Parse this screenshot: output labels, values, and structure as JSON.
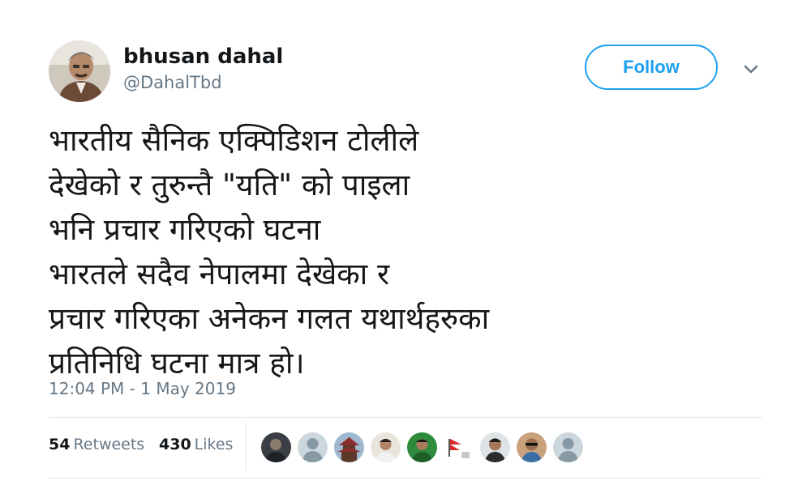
{
  "tweet": {
    "author": {
      "display_name": "bhusan dahal",
      "handle": "@DahalTbd",
      "avatar": "profile-photo"
    },
    "follow_label": "Follow",
    "caret_icon": "chevron-down-icon",
    "text_lines": [
      "भारतीय सैनिक एक्पिडिशन टोलीले",
      "देखेको र तुरुन्तै \"यति\" को पाइला",
      "भनि प्रचार गरिएको घटना",
      "भारतले सदैव नेपालमा देखेका र",
      "प्रचार गरिएका अनेकन गलत यथार्थहरुका",
      "प्रतिनिधि घटना मात्र हो।"
    ],
    "timestamp": "12:04 PM - 1 May 2019",
    "stats": {
      "retweets_count": "54",
      "retweets_label": "Retweets",
      "likes_count": "430",
      "likes_label": "Likes"
    },
    "liker_avatars": [
      "liker-avatar-dark",
      "liker-avatar-default",
      "liker-avatar-pagoda",
      "liker-avatar-person",
      "liker-avatar-green",
      "liker-avatar-flag",
      "liker-avatar-person",
      "liker-avatar-sunglasses",
      "liker-avatar-default"
    ]
  },
  "colors": {
    "brand_blue": "#1da1f2",
    "text_primary": "#14171a",
    "text_secondary": "#657786",
    "divider": "#e1e8ed"
  }
}
